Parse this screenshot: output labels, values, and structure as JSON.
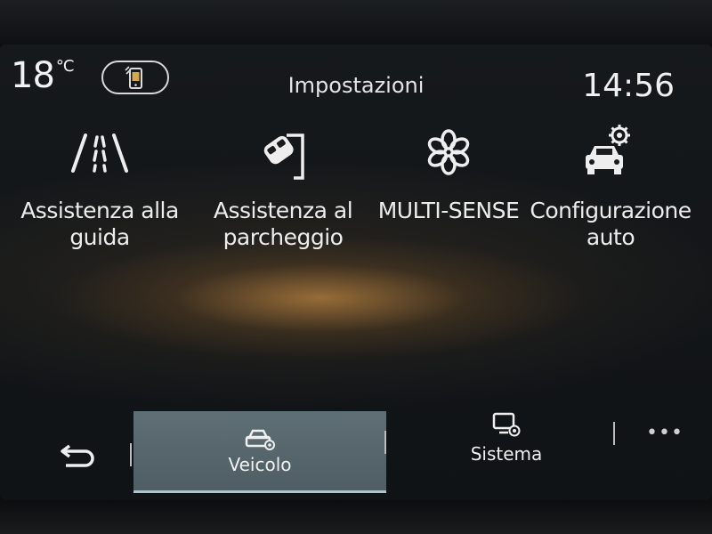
{
  "status_bar": {
    "temperature": "18",
    "temperature_unit": "°C",
    "title": "Impostazioni",
    "time": "14:56"
  },
  "tiles": [
    {
      "label_line1": "Assistenza alla",
      "label_line2": "guida",
      "icon": "lane-assist-icon"
    },
    {
      "label_line1": "Assistenza al",
      "label_line2": "parcheggio",
      "icon": "parking-assist-icon"
    },
    {
      "label_line1": "MULTI-SENSE",
      "label_line2": "",
      "icon": "multi-sense-flower-icon"
    },
    {
      "label_line1": "Configurazione",
      "label_line2": "auto",
      "icon": "car-settings-icon"
    }
  ],
  "bottom_bar": {
    "tabs": [
      {
        "label": "Veicolo",
        "icon": "car-gear-icon",
        "active": true
      },
      {
        "label": "Sistema",
        "icon": "screen-gear-icon",
        "active": false
      }
    ],
    "more": "•••"
  },
  "colors": {
    "active_tab": "#5a6a70",
    "active_tab_underline": "#a9c6cf",
    "background": "#121518",
    "text": "#eaeaea"
  }
}
